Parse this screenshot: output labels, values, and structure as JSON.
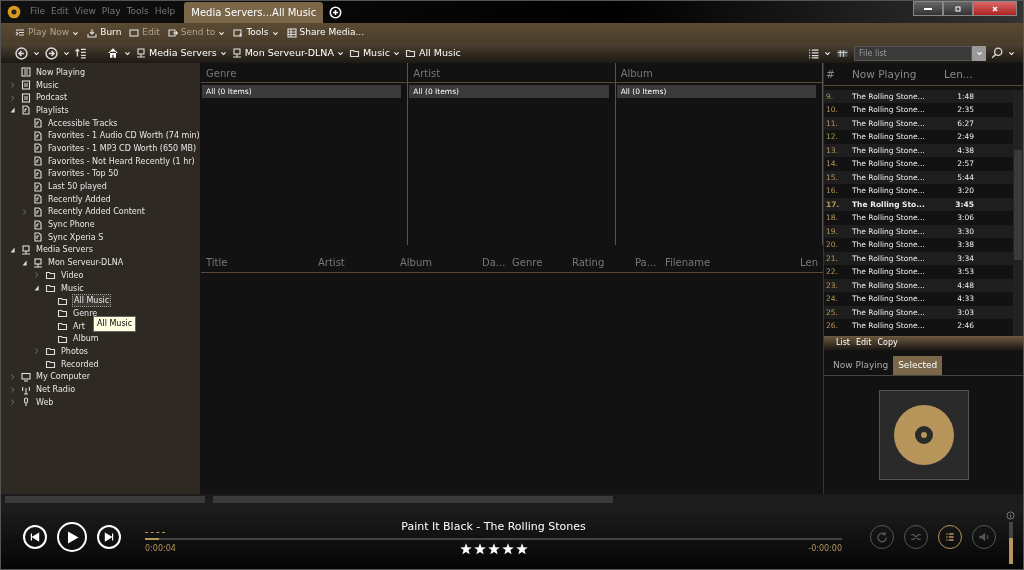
{
  "menu": [
    "File",
    "Edit",
    "View",
    "Play",
    "Tools",
    "Help"
  ],
  "tabs": [
    {
      "label": "Media Servers...All Music",
      "selected": true
    }
  ],
  "toolbar": [
    {
      "label": "Play Now",
      "kind": "playnow",
      "disabled": true,
      "dropdown": true
    },
    {
      "label": "Burn",
      "kind": "burn",
      "disabled": false,
      "dropdown": false
    },
    {
      "label": "Edit",
      "kind": "edit",
      "disabled": true,
      "dropdown": false
    },
    {
      "label": "Send to",
      "kind": "send",
      "disabled": true,
      "dropdown": true
    },
    {
      "label": "Tools",
      "kind": "tools",
      "disabled": false,
      "dropdown": true
    },
    {
      "label": "Share Media...",
      "kind": "share",
      "disabled": false,
      "dropdown": false
    }
  ],
  "breadcrumb": [
    {
      "label": "Media Servers",
      "kind": "server",
      "dropdown": true
    },
    {
      "label": "Mon Serveur-DLNA",
      "kind": "server",
      "dropdown": true
    },
    {
      "label": "Music",
      "kind": "folder",
      "dropdown": true
    },
    {
      "label": "All Music",
      "kind": "folder",
      "dropdown": false
    }
  ],
  "search": {
    "placeholder": "File list"
  },
  "tree": [
    {
      "label": "Now Playing",
      "kind": "nowplaying"
    },
    {
      "label": "Music",
      "kind": "library",
      "expanded": false
    },
    {
      "label": "Podcast",
      "kind": "library",
      "expanded": false
    },
    {
      "label": "Playlists",
      "kind": "playlist",
      "expanded": true,
      "children": [
        {
          "label": "Accessible Tracks",
          "kind": "playlist"
        },
        {
          "label": "Favorites - 1 Audio CD Worth (74 min)",
          "kind": "playlist"
        },
        {
          "label": "Favorites - 1 MP3 CD Worth (650 MB)",
          "kind": "playlist"
        },
        {
          "label": "Favorites - Not Heard Recently (1 hr)",
          "kind": "playlist"
        },
        {
          "label": "Favorites - Top 50",
          "kind": "playlist"
        },
        {
          "label": "Last 50 played",
          "kind": "playlist"
        },
        {
          "label": "Recently Added",
          "kind": "playlist"
        },
        {
          "label": "Recently Added Content",
          "kind": "playlist",
          "expanded": false
        },
        {
          "label": "Sync Phone",
          "kind": "playlist"
        },
        {
          "label": "Sync Xperia S",
          "kind": "playlist"
        }
      ]
    },
    {
      "label": "Media Servers",
      "kind": "server",
      "expanded": true,
      "children": [
        {
          "label": "Mon Serveur-DLNA",
          "kind": "server",
          "expanded": true,
          "children": [
            {
              "label": "Video",
              "kind": "folder",
              "expanded": false
            },
            {
              "label": "Music",
              "kind": "folder",
              "expanded": true,
              "children": [
                {
                  "label": "All Music",
                  "kind": "folder",
                  "selected": true
                },
                {
                  "label": "Genre",
                  "kind": "folder",
                  "selected": false
                },
                {
                  "label": "Art",
                  "kind": "folder",
                  "selected": false
                },
                {
                  "label": "Album",
                  "kind": "folder",
                  "selected": false
                }
              ]
            },
            {
              "label": "Photos",
              "kind": "folder",
              "expanded": false
            },
            {
              "label": "Recorded",
              "kind": "folder"
            }
          ]
        }
      ]
    },
    {
      "label": "My Computer",
      "kind": "computer",
      "expanded": false
    },
    {
      "label": "Net Radio",
      "kind": "radio",
      "expanded": false
    },
    {
      "label": "Web",
      "kind": "web",
      "expanded": false
    }
  ],
  "tooltip": "All Music",
  "browser": [
    {
      "title": "Genre",
      "items": [
        "All (0 Items)"
      ]
    },
    {
      "title": "Artist",
      "items": [
        "All (0 Items)"
      ]
    },
    {
      "title": "Album",
      "items": [
        "All (0 Items)"
      ]
    }
  ],
  "table": {
    "columns": [
      "Title",
      "Artist",
      "Album",
      "Da...",
      "Genre",
      "Rating",
      "Pa...",
      "Filename",
      "Len"
    ]
  },
  "playlist": {
    "columns": [
      "#",
      "Now Playing",
      "Len..."
    ],
    "rows": [
      {
        "number": "9.",
        "title": "The Rolling Stone...",
        "length": "1:48",
        "current": false
      },
      {
        "number": "10.",
        "title": "The Rolling Stone...",
        "length": "2:35",
        "current": false
      },
      {
        "number": "11.",
        "title": "The Rolling Stone...",
        "length": "6:27",
        "current": false
      },
      {
        "number": "12.",
        "title": "The Rolling Stone...",
        "length": "2:49",
        "current": false
      },
      {
        "number": "13.",
        "title": "The Rolling Stone...",
        "length": "4:38",
        "current": false
      },
      {
        "number": "14.",
        "title": "The Rolling Stone...",
        "length": "2:57",
        "current": false
      },
      {
        "number": "15.",
        "title": "The Rolling Stone...",
        "length": "5:44",
        "current": false
      },
      {
        "number": "16.",
        "title": "The Rolling Stone...",
        "length": "3:20",
        "current": false
      },
      {
        "number": "17.",
        "title": "The Rolling Sto...",
        "length": "3:45",
        "current": true
      },
      {
        "number": "18.",
        "title": "The Rolling Stone...",
        "length": "3:06",
        "current": false
      },
      {
        "number": "19.",
        "title": "The Rolling Stone...",
        "length": "3:30",
        "current": false
      },
      {
        "number": "20.",
        "title": "The Rolling Stone...",
        "length": "3:38",
        "current": false
      },
      {
        "number": "21.",
        "title": "The Rolling Stone...",
        "length": "3:34",
        "current": false
      },
      {
        "number": "22.",
        "title": "The Rolling Stone...",
        "length": "3:53",
        "current": false
      },
      {
        "number": "23.",
        "title": "The Rolling Stone...",
        "length": "4:48",
        "current": false
      },
      {
        "number": "24.",
        "title": "The Rolling Stone...",
        "length": "4:33",
        "current": false
      },
      {
        "number": "25.",
        "title": "The Rolling Stone...",
        "length": "3:03",
        "current": false
      },
      {
        "number": "26.",
        "title": "The Rolling Stone...",
        "length": "2:46",
        "current": false
      }
    ]
  },
  "panel_menu": [
    "List",
    "Edit",
    "Copy"
  ],
  "panel_tabs": [
    {
      "label": "Now Playing",
      "selected": false
    },
    {
      "label": "Selected",
      "selected": true
    }
  ],
  "player": {
    "track": "Paint It Black - The Rolling Stones",
    "elapsed": "0:00:04",
    "remaining": "-0:00:00",
    "level": 0.02,
    "stars": 5,
    "controls": [
      {
        "kind": "repeat",
        "active": false
      },
      {
        "kind": "shuffle",
        "active": false
      },
      {
        "kind": "list",
        "active": true
      },
      {
        "kind": "volume",
        "active": false
      }
    ],
    "volume": {
      "level": 0.6
    }
  }
}
